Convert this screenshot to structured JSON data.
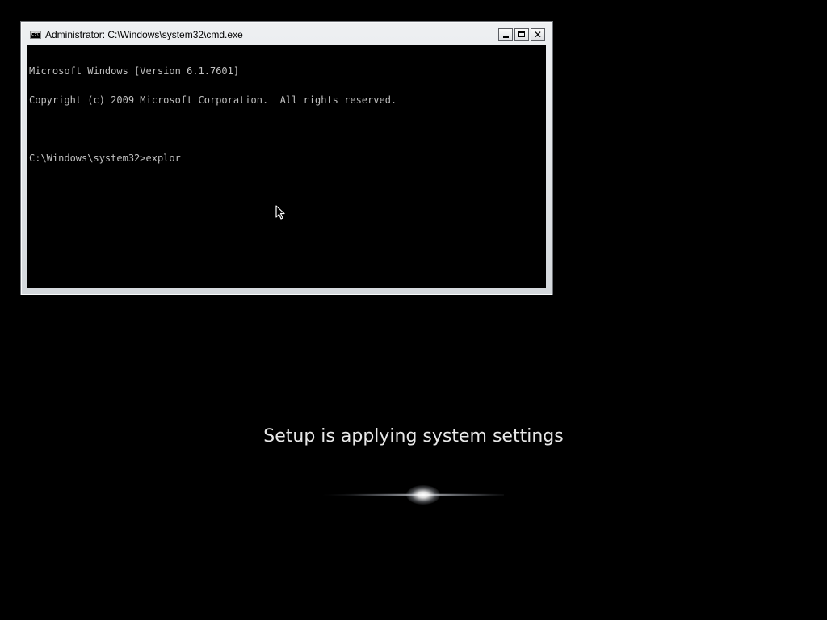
{
  "cmd_window": {
    "title": "Administrator: C:\\Windows\\system32\\cmd.exe",
    "icon": "console-app-icon",
    "buttons": {
      "minimize": "minimize-icon",
      "maximize": "maximize-icon",
      "close_label": "✕"
    },
    "console_lines": [
      "Microsoft Windows [Version 6.1.7601]",
      "Copyright (c) 2009 Microsoft Corporation.  All rights reserved.",
      "",
      "C:\\Windows\\system32>explor"
    ],
    "colors": {
      "console_background": "#000000",
      "console_text": "#c0c0c0"
    }
  },
  "setup": {
    "status_text": "Setup is applying system settings",
    "indicator": "glowing-progress-animation"
  },
  "cursor": {
    "icon": "mouse-pointer-icon"
  }
}
